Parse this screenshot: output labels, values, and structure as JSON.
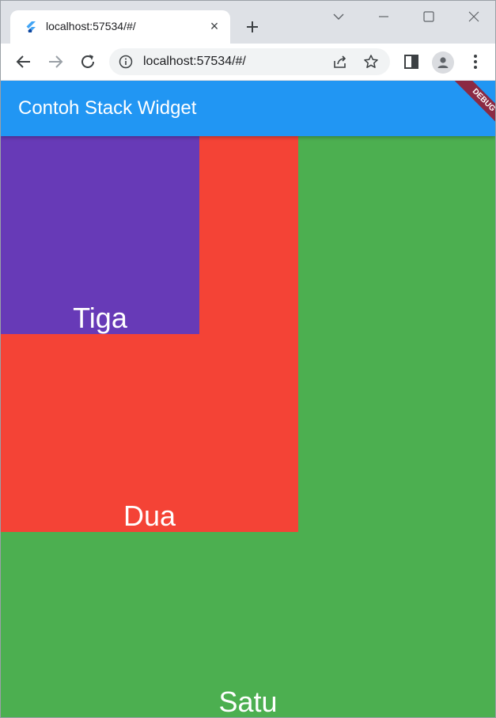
{
  "browser": {
    "tab_title": "localhost:57534/#/",
    "url": "localhost:57534/#/"
  },
  "app": {
    "title": "Contoh Stack Widget",
    "debug_banner": "DEBUG",
    "boxes": {
      "satu": "Satu",
      "dua": "Dua",
      "tiga": "Tiga"
    }
  },
  "colors": {
    "appbar": "#2196f3",
    "satu": "#4caf50",
    "dua": "#f44336",
    "tiga": "#673ab7",
    "debug": "#8b2a43"
  }
}
